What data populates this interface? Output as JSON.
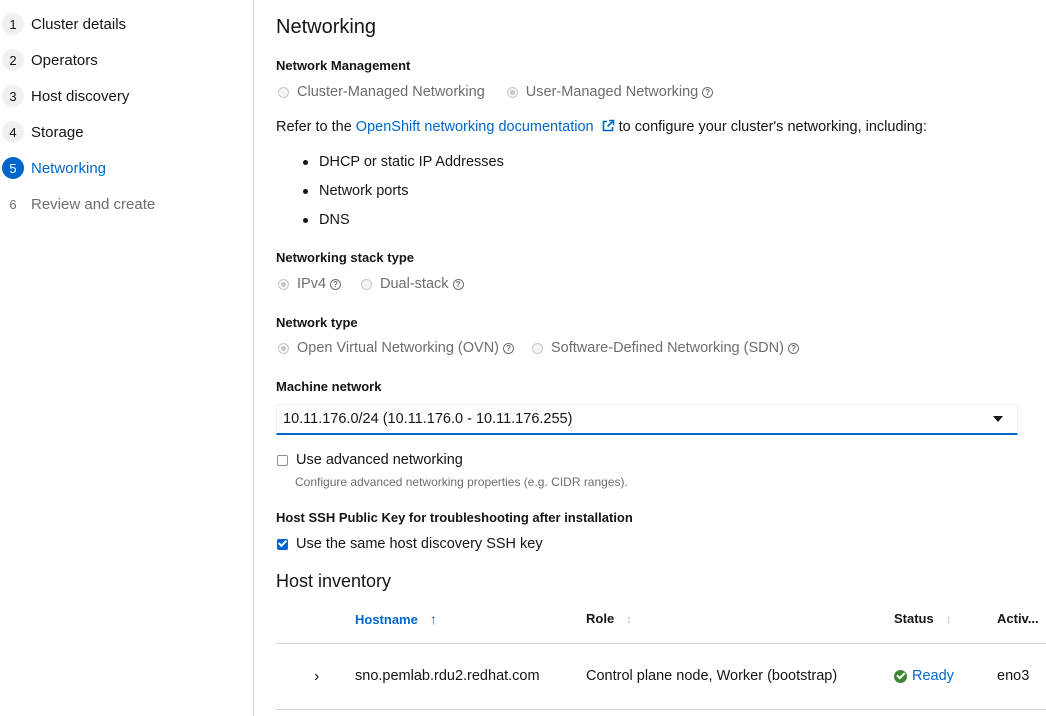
{
  "wizard": {
    "steps": [
      {
        "num": "1",
        "label": "Cluster details"
      },
      {
        "num": "2",
        "label": "Operators"
      },
      {
        "num": "3",
        "label": "Host discovery"
      },
      {
        "num": "4",
        "label": "Storage"
      },
      {
        "num": "5",
        "label": "Networking",
        "state": "current"
      },
      {
        "num": "6",
        "label": "Review and create",
        "state": "disabled"
      }
    ]
  },
  "networking": {
    "title": "Networking",
    "management": {
      "heading": "Network Management",
      "options": [
        "Cluster-Managed Networking",
        "User-Managed Networking"
      ],
      "selected": "User-Managed Networking"
    },
    "refer": {
      "prefix": "Refer to the ",
      "link": "OpenShift networking documentation",
      "suffix": " to configure your cluster's networking, including:"
    },
    "bullets": [
      "DHCP or static IP Addresses",
      "Network ports",
      "DNS"
    ],
    "stack": {
      "heading": "Networking stack type",
      "options": [
        "IPv4",
        "Dual-stack"
      ],
      "selected": "IPv4"
    },
    "type": {
      "heading": "Network type",
      "options": [
        "Open Virtual Networking (OVN)",
        "Software-Defined Networking (SDN)"
      ],
      "selected": "Open Virtual Networking (OVN)"
    },
    "machine": {
      "heading": "Machine network",
      "value": "10.11.176.0/24 (10.11.176.0 - 10.11.176.255)"
    },
    "advanced": {
      "label": "Use advanced networking",
      "description": "Configure advanced networking properties (e.g. CIDR ranges).",
      "checked": false
    },
    "ssh": {
      "heading": "Host SSH Public Key for troubleshooting after installation",
      "label": "Use the same host discovery SSH key",
      "checked": true
    }
  },
  "inventory": {
    "title": "Host inventory",
    "columns": {
      "hostname": "Hostname",
      "role": "Role",
      "status": "Status",
      "active": "Activ..."
    },
    "rows": [
      {
        "hostname": "sno.pemlab.rdu2.redhat.com",
        "role": "Control plane node, Worker (bootstrap)",
        "status": "Ready",
        "active": "eno3"
      }
    ]
  },
  "colors": {
    "accent": "#0066cc",
    "success": "#3e8635",
    "muted": "#6a6e73"
  },
  "icons": [
    "help-icon",
    "external-link-icon",
    "caret-down-icon",
    "sort-asc-icon",
    "sort-icon",
    "expand-icon",
    "check-circle-icon"
  ]
}
